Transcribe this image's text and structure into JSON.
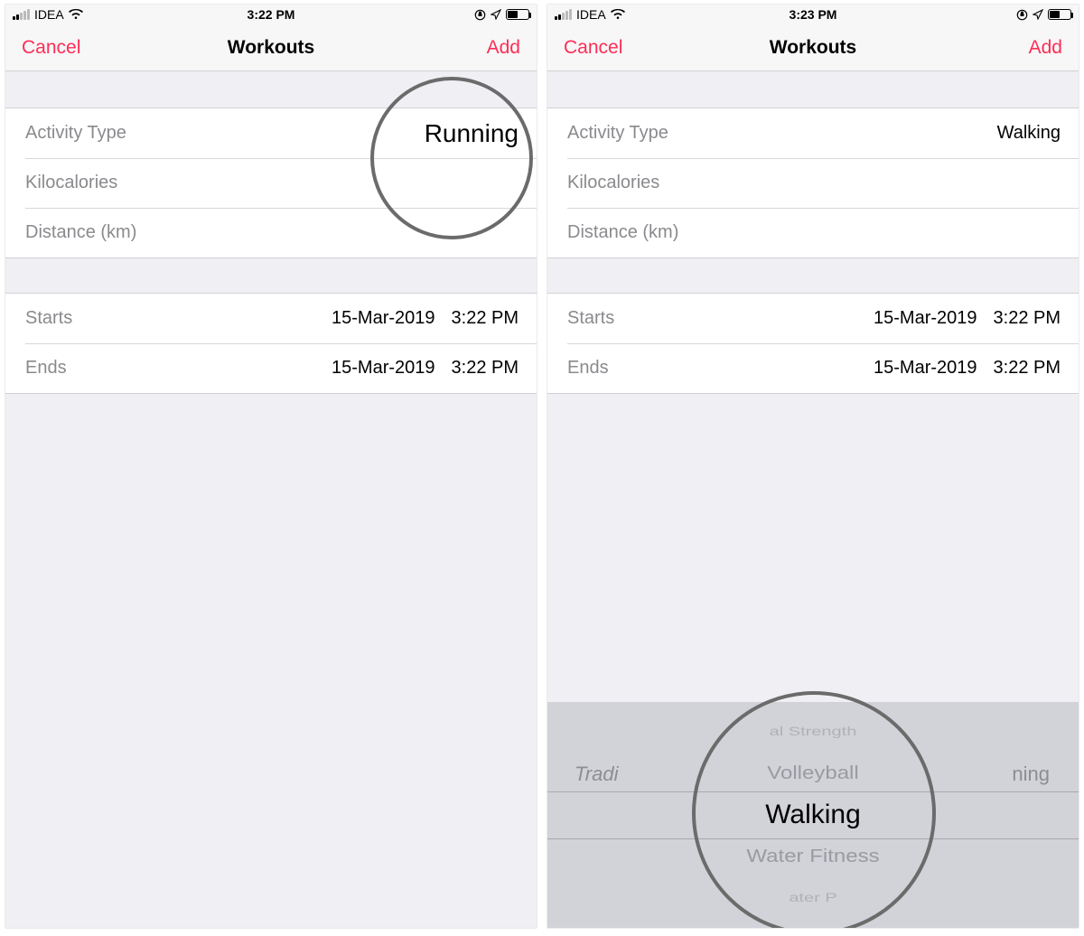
{
  "screens": [
    {
      "status": {
        "carrier": "IDEA",
        "time": "3:22 PM"
      },
      "nav": {
        "cancel": "Cancel",
        "title": "Workouts",
        "add": "Add"
      },
      "group1": {
        "activity_label": "Activity Type",
        "activity_value": "Running",
        "kcal_label": "Kilocalories",
        "distance_label": "Distance (km)"
      },
      "group2": {
        "starts_label": "Starts",
        "starts_date": "15-Mar-2019",
        "starts_time": "3:22 PM",
        "ends_label": "Ends",
        "ends_date": "15-Mar-2019",
        "ends_time": "3:22 PM"
      }
    },
    {
      "status": {
        "carrier": "IDEA",
        "time": "3:23 PM"
      },
      "nav": {
        "cancel": "Cancel",
        "title": "Workouts",
        "add": "Add"
      },
      "group1": {
        "activity_label": "Activity Type",
        "activity_value": "Walking",
        "kcal_label": "Kilocalories",
        "distance_label": "Distance (km)"
      },
      "group2": {
        "starts_label": "Starts",
        "starts_date": "15-Mar-2019",
        "starts_time": "3:22 PM",
        "ends_label": "Ends",
        "ends_date": "15-Mar-2019",
        "ends_time": "3:22 PM"
      },
      "picker": {
        "side_left": "Tradi",
        "side_right": "ning",
        "above2": "al Strength",
        "above1": "Volleyball",
        "selected": "Walking",
        "below1": "Water Fitness",
        "below2": "ater P"
      }
    }
  ],
  "accent": "#ff2d55"
}
